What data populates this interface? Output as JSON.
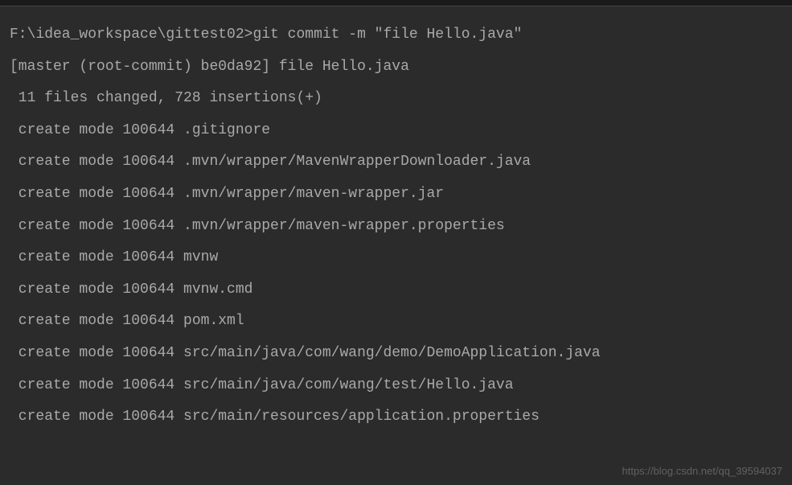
{
  "terminal": {
    "prompt_path": "F:\\idea_workspace\\gittest02>",
    "command": "git commit -m \"file Hello.java\"",
    "output": [
      "[master (root-commit) be0da92] file Hello.java",
      " 11 files changed, 728 insertions(+)",
      " create mode 100644 .gitignore",
      " create mode 100644 .mvn/wrapper/MavenWrapperDownloader.java",
      " create mode 100644 .mvn/wrapper/maven-wrapper.jar",
      " create mode 100644 .mvn/wrapper/maven-wrapper.properties",
      " create mode 100644 mvnw",
      " create mode 100644 mvnw.cmd",
      " create mode 100644 pom.xml",
      " create mode 100644 src/main/java/com/wang/demo/DemoApplication.java",
      " create mode 100644 src/main/java/com/wang/test/Hello.java",
      " create mode 100644 src/main/resources/application.properties"
    ]
  },
  "watermark": "https://blog.csdn.net/qq_39594037"
}
